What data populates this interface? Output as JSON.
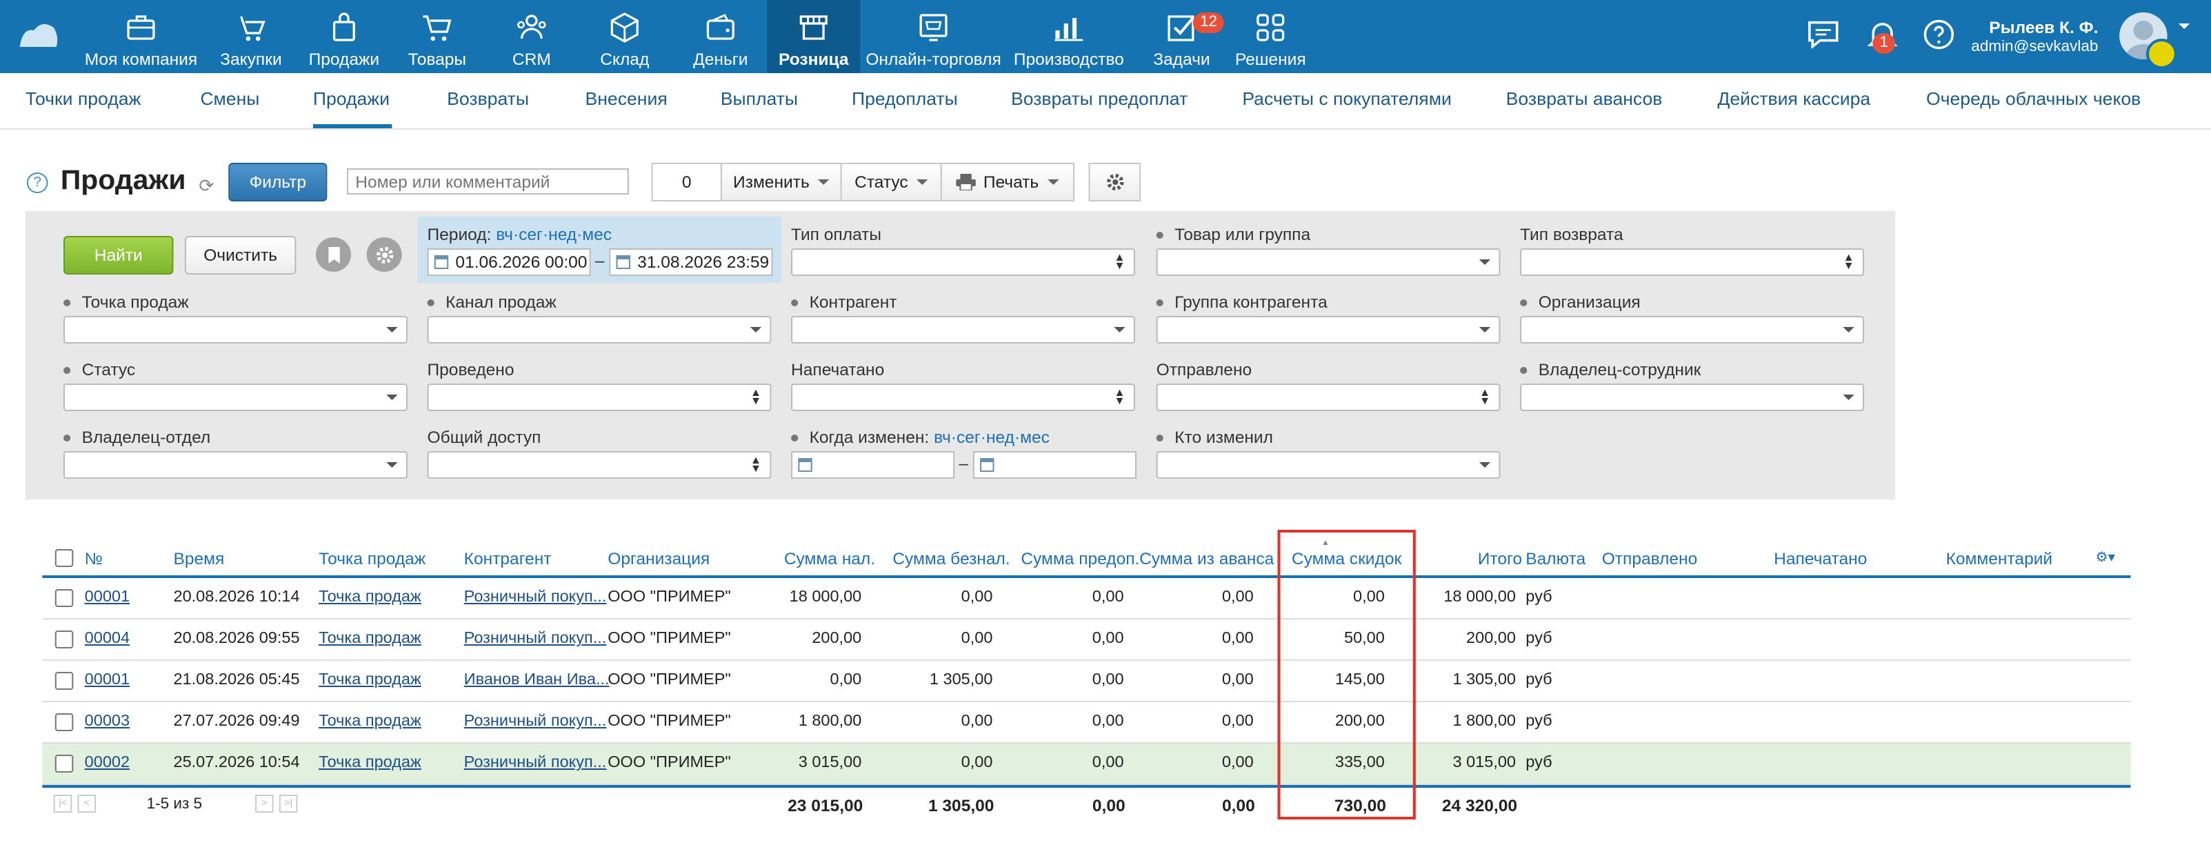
{
  "topnav": {
    "items": [
      {
        "label": "Моя компания",
        "icon": "briefcase-icon"
      },
      {
        "label": "Закупки",
        "icon": "purchase-icon"
      },
      {
        "label": "Продажи",
        "icon": "bag-icon"
      },
      {
        "label": "Товары",
        "icon": "cart-icon"
      },
      {
        "label": "CRM",
        "icon": "people-icon"
      },
      {
        "label": "Склад",
        "icon": "box-icon"
      },
      {
        "label": "Деньги",
        "icon": "wallet-icon"
      },
      {
        "label": "Розница",
        "icon": "store-icon"
      },
      {
        "label": "Онлайн-торговля",
        "icon": "online-store-icon"
      },
      {
        "label": "Производство",
        "icon": "bar-chart-icon"
      },
      {
        "label": "Задачи",
        "icon": "checkbox-icon"
      },
      {
        "label": "Решения",
        "icon": "apps-icon"
      }
    ],
    "tasks_badge": "12",
    "notifications_badge": "1",
    "user_name": "Рылеев К. Ф.",
    "user_email": "admin@sevkavlab"
  },
  "subnav": [
    "Точки продаж",
    "Смены",
    "Продажи",
    "Возвраты",
    "Внесения",
    "Выплаты",
    "Предоплаты",
    "Возвраты предоплат",
    "Расчеты с покупателями",
    "Возвраты авансов",
    "Действия кассира",
    "Очередь облачных чеков"
  ],
  "toolbar": {
    "title": "Продажи",
    "help": "?",
    "filter_btn": "Фильтр",
    "search_placeholder": "Номер или комментарий",
    "count": "0",
    "change": "Изменить",
    "status": "Статус",
    "print": "Печать"
  },
  "filter": {
    "find": "Найти",
    "clear": "Очистить",
    "period_label": "Период:",
    "period_links": "вч·сег·нед·мес",
    "date_from": "01.06.2026 00:00",
    "date_to": "31.08.2026 23:59",
    "dash": "–",
    "payment_type": "Тип оплаты",
    "product_group": "Товар или группа",
    "return_type": "Тип возврата",
    "sale_point": "Точка продаж",
    "sale_channel": "Канал продаж",
    "counterparty": "Контрагент",
    "counterparty_group": "Группа контрагента",
    "organization": "Организация",
    "status": "Статус",
    "posted": "Проведено",
    "printed": "Напечатано",
    "sent": "Отправлено",
    "owner_employee": "Владелец-сотрудник",
    "owner_department": "Владелец-отдел",
    "shared": "Общий доступ",
    "changed_when": "Когда изменен:",
    "changed_links": "вч·сег·нед·мес",
    "changed_by": "Кто изменил"
  },
  "table": {
    "headers": {
      "num": "№",
      "time": "Время",
      "point": "Точка продаж",
      "counterparty": "Контрагент",
      "org": "Организация",
      "cash": "Сумма нал.",
      "noncash": "Сумма безнал.",
      "prepay": "Сумма предоп.",
      "advance": "Сумма из аванса",
      "discount": "Сумма скидок",
      "total": "Итого",
      "currency": "Валюта",
      "sent": "Отправлено",
      "printed": "Напечатано",
      "comment": "Комментарий"
    },
    "rows": [
      {
        "num": "00001",
        "time": "20.08.2026 10:14",
        "point": "Точка продаж",
        "cp": "Розничный покуп...",
        "org": "ООО \"ПРИМЕР\"",
        "cash": "18 000,00",
        "noncash": "0,00",
        "prepay": "0,00",
        "advance": "0,00",
        "discount": "0,00",
        "total": "18 000,00",
        "cur": "руб"
      },
      {
        "num": "00004",
        "time": "20.08.2026 09:55",
        "point": "Точка продаж",
        "cp": "Розничный покуп...",
        "org": "ООО \"ПРИМЕР\"",
        "cash": "200,00",
        "noncash": "0,00",
        "prepay": "0,00",
        "advance": "0,00",
        "discount": "50,00",
        "total": "200,00",
        "cur": "руб"
      },
      {
        "num": "00001",
        "time": "21.08.2026 05:45",
        "point": "Точка продаж",
        "cp": "Иванов Иван Ива...",
        "org": "ООО \"ПРИМЕР\"",
        "cash": "0,00",
        "noncash": "1 305,00",
        "prepay": "0,00",
        "advance": "0,00",
        "discount": "145,00",
        "total": "1 305,00",
        "cur": "руб"
      },
      {
        "num": "00003",
        "time": "27.07.2026 09:49",
        "point": "Точка продаж",
        "cp": "Розничный покуп...",
        "org": "ООО \"ПРИМЕР\"",
        "cash": "1 800,00",
        "noncash": "0,00",
        "prepay": "0,00",
        "advance": "0,00",
        "discount": "200,00",
        "total": "1 800,00",
        "cur": "руб"
      },
      {
        "num": "00002",
        "time": "25.07.2026 10:54",
        "point": "Точка продаж",
        "cp": "Розничный покуп...",
        "org": "ООО \"ПРИМЕР\"",
        "cash": "3 015,00",
        "noncash": "0,00",
        "prepay": "0,00",
        "advance": "0,00",
        "discount": "335,00",
        "total": "3 015,00",
        "cur": "руб"
      }
    ],
    "pager": "1-5 из 5",
    "totals": {
      "cash": "23 015,00",
      "noncash": "1 305,00",
      "prepay": "0,00",
      "advance": "0,00",
      "discount": "730,00",
      "total": "24 320,00"
    }
  }
}
